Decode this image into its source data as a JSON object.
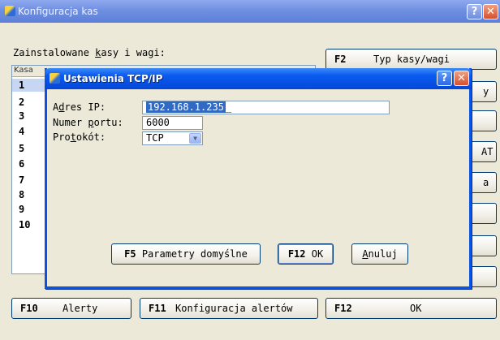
{
  "window": {
    "title": "Konfiguracja kas"
  },
  "main": {
    "list_label_pre": "Zainstalowane ",
    "list_label_ul": "k",
    "list_label_post": "asy i wagi:",
    "grid_header": "Kasa",
    "rows": [
      "1",
      "2",
      "3",
      "4",
      "5",
      "6",
      "7",
      "8",
      "9",
      "10"
    ]
  },
  "side_buttons": {
    "f2_key": "F2",
    "f2_label": "Typ kasy/wagi",
    "b2_partial": "y",
    "b4_partial": "AT",
    "b5_partial": "a"
  },
  "bottom_buttons": {
    "f10_key": "F10",
    "f10_label": "Alerty",
    "f11_key": "F11",
    "f11_label": "Konfiguracja alertów",
    "f12_key": "F12",
    "f12_label": "OK"
  },
  "dialog": {
    "title": "Ustawienia TCP/IP",
    "ip_label_pre": "A",
    "ip_label_ul": "d",
    "ip_label_post": "res IP:",
    "ip_value": "192.168.1.235",
    "port_label_pre": "Numer ",
    "port_label_ul": "p",
    "port_label_post": "ortu:",
    "port_value": "6000",
    "proto_label_pre": "Pro",
    "proto_label_ul": "t",
    "proto_label_post": "okót:",
    "proto_value": "TCP",
    "btn_defaults_key": "F5",
    "btn_defaults_label": "Parametry domyślne",
    "btn_ok_key": "F12",
    "btn_ok_label": "OK",
    "btn_cancel_ul": "A",
    "btn_cancel_rest": "nuluj"
  },
  "colors": {
    "titlebar": "#6f8fe0",
    "dialog_titlebar": "#0a5bf0",
    "selection": "#316ac5"
  }
}
